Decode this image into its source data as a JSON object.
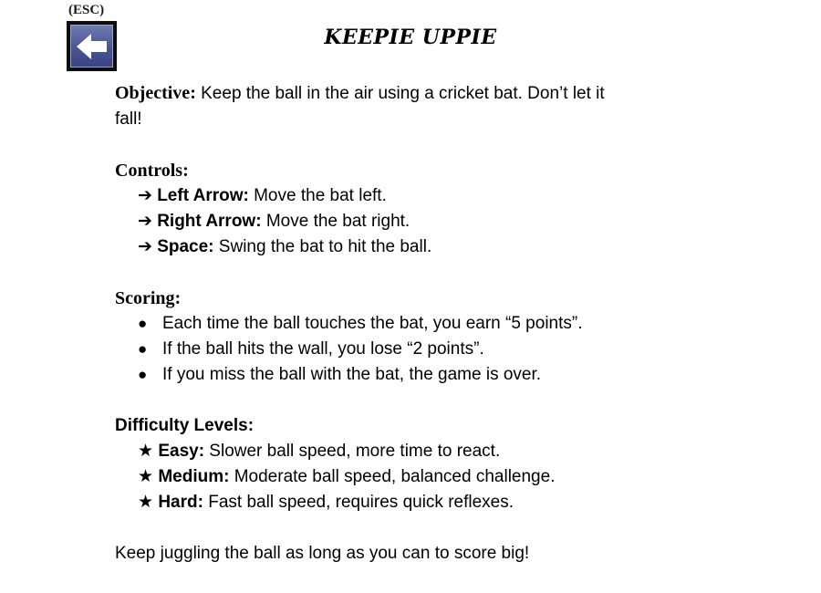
{
  "esc_label": "(ESC)",
  "back_icon": "back-arrow-icon",
  "title": "KEEPIE UPPIE",
  "objective": {
    "label": "Objective:",
    "line1": " Keep the ball in the air using a cricket bat. Don’t let it",
    "line2": "fall!"
  },
  "controls": {
    "heading": "Controls:",
    "items": [
      {
        "marker": "➔",
        "key": "Left Arrow:",
        "desc": " Move the bat left."
      },
      {
        "marker": "➔",
        "key": "Right Arrow:",
        "desc": " Move the bat right."
      },
      {
        "marker": "➔",
        "key": "Space:",
        "desc": " Swing the bat to hit the ball."
      }
    ]
  },
  "scoring": {
    "heading": "Scoring:",
    "marker": "●",
    "items": [
      "Each time the ball touches the bat, you earn “5 points”.",
      "If the ball hits the wall, you lose “2 points”.",
      "If you miss the ball with the bat, the game is over."
    ]
  },
  "difficulty": {
    "heading": "Difficulty Levels:",
    "items": [
      {
        "marker": "★",
        "level": "Easy:",
        "desc": " Slower ball speed, more time to react."
      },
      {
        "marker": "★",
        "level": "Medium:",
        "desc": " Moderate ball speed, balanced challenge."
      },
      {
        "marker": "★",
        "level": "Hard:",
        "desc": " Fast ball speed, requires quick reflexes."
      }
    ]
  },
  "footer": "Keep juggling the ball as long as you can to score big!"
}
